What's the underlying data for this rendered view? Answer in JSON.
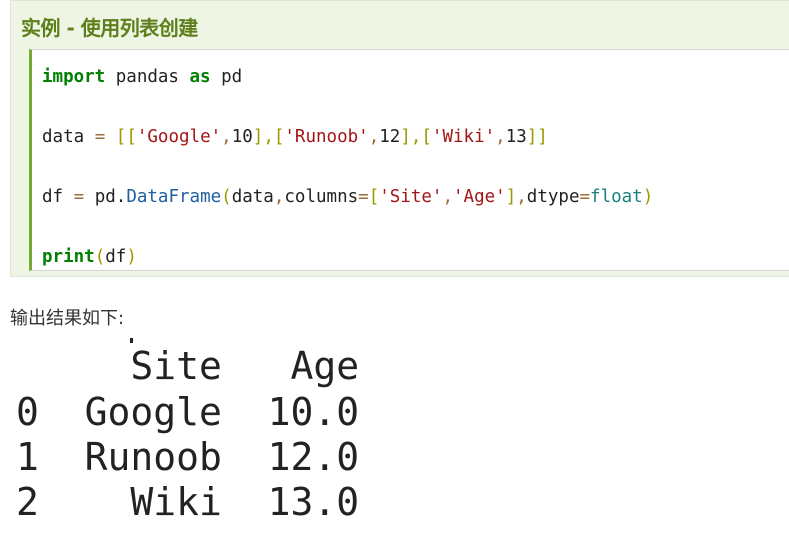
{
  "example": {
    "title": "实例 - 使用列表创建"
  },
  "code": {
    "lines": [
      [
        {
          "t": "import",
          "c": "kw"
        },
        {
          "t": " pandas ",
          "c": ""
        },
        {
          "t": "as",
          "c": "kw"
        },
        {
          "t": " pd",
          "c": ""
        }
      ],
      [
        {
          "t": "data ",
          "c": ""
        },
        {
          "t": "=",
          "c": "op"
        },
        {
          "t": " ",
          "c": ""
        },
        {
          "t": "[[",
          "c": "br"
        },
        {
          "t": "'Google'",
          "c": "str"
        },
        {
          "t": ",",
          "c": "op"
        },
        {
          "t": "10",
          "c": "num"
        },
        {
          "t": "],[",
          "c": "br"
        },
        {
          "t": "'Runoob'",
          "c": "str"
        },
        {
          "t": ",",
          "c": "op"
        },
        {
          "t": "12",
          "c": "num"
        },
        {
          "t": "],[",
          "c": "br"
        },
        {
          "t": "'Wiki'",
          "c": "str"
        },
        {
          "t": ",",
          "c": "op"
        },
        {
          "t": "13",
          "c": "num"
        },
        {
          "t": "]]",
          "c": "br"
        }
      ],
      [
        {
          "t": "df ",
          "c": ""
        },
        {
          "t": "=",
          "c": "op"
        },
        {
          "t": " pd.",
          "c": ""
        },
        {
          "t": "DataFrame",
          "c": "cls"
        },
        {
          "t": "(",
          "c": "br"
        },
        {
          "t": "data",
          "c": ""
        },
        {
          "t": ",",
          "c": "op"
        },
        {
          "t": "columns",
          "c": ""
        },
        {
          "t": "=",
          "c": "op"
        },
        {
          "t": "[",
          "c": "br"
        },
        {
          "t": "'Site'",
          "c": "str"
        },
        {
          "t": ",",
          "c": "op"
        },
        {
          "t": "'Age'",
          "c": "str"
        },
        {
          "t": "]",
          "c": "br"
        },
        {
          "t": ",",
          "c": "op"
        },
        {
          "t": "dtype",
          "c": ""
        },
        {
          "t": "=",
          "c": "op"
        },
        {
          "t": "float",
          "c": "bi"
        },
        {
          "t": ")",
          "c": "br"
        }
      ],
      [
        {
          "t": "print",
          "c": "kw"
        },
        {
          "t": "(",
          "c": "br"
        },
        {
          "t": "df",
          "c": ""
        },
        {
          "t": ")",
          "c": "br"
        }
      ]
    ]
  },
  "output": {
    "label": "输出结果如下:",
    "rows": [
      "     Site   Age",
      "0  Google  10.0",
      "1  Runoob  12.0",
      "2    Wiki  13.0"
    ]
  },
  "colors": {
    "title_green": "#5d7f1a",
    "box_bg": "#eef5e4",
    "code_border": "#72aa34"
  }
}
